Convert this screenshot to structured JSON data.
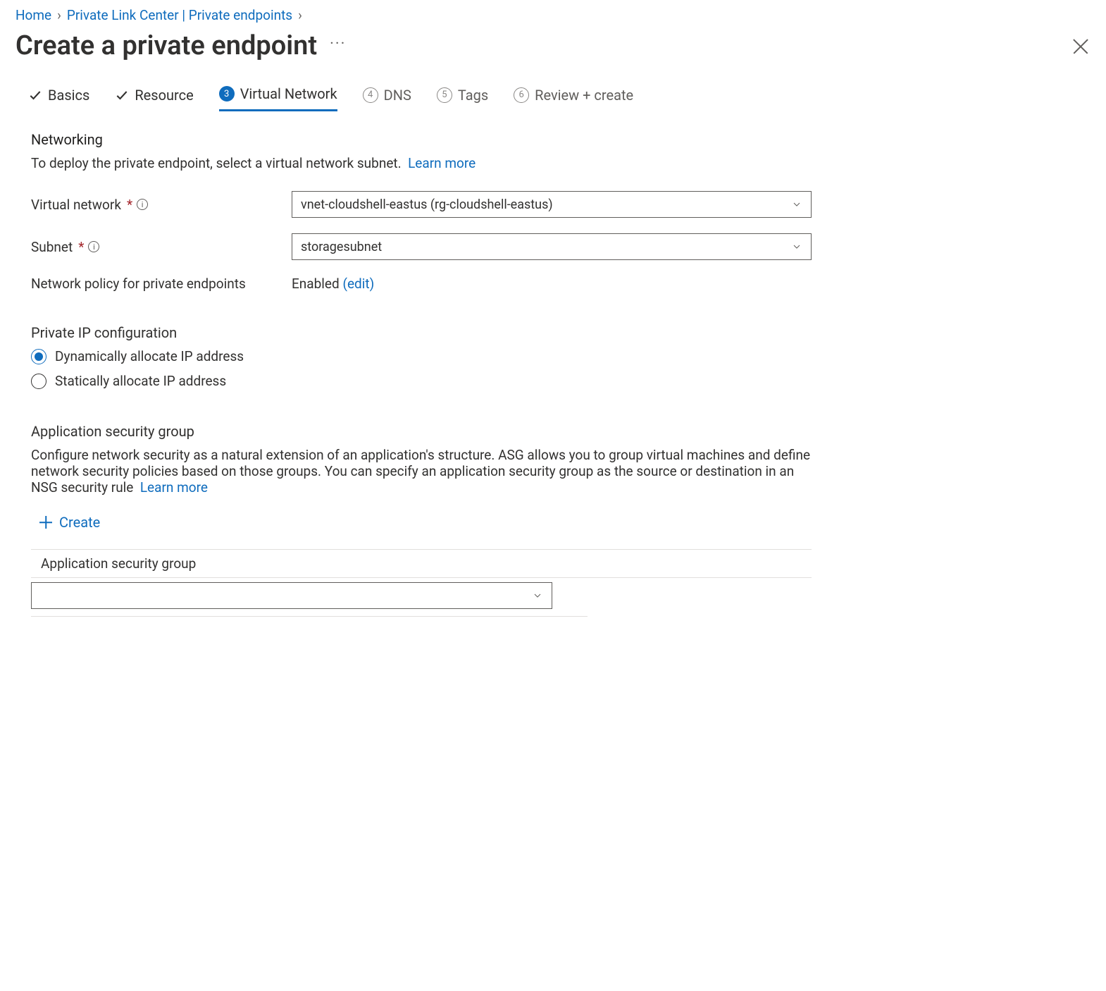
{
  "breadcrumb": {
    "home": "Home",
    "plc": "Private Link Center | Private endpoints"
  },
  "page_title": "Create a private endpoint",
  "tabs": {
    "basics": "Basics",
    "resource": "Resource",
    "vnet": "Virtual Network",
    "dns": "DNS",
    "tags": "Tags",
    "review": "Review + create",
    "step3": "3",
    "step4": "4",
    "step5": "5",
    "step6": "6"
  },
  "networking": {
    "heading": "Networking",
    "desc": "To deploy the private endpoint, select a virtual network subnet.",
    "learn_more": "Learn more",
    "vnet_label": "Virtual network",
    "vnet_value": "vnet-cloudshell-eastus (rg-cloudshell-eastus)",
    "subnet_label": "Subnet",
    "subnet_value": "storagesubnet",
    "policy_label": "Network policy for private endpoints",
    "policy_value": "Enabled",
    "policy_edit": "(edit)"
  },
  "ipconfig": {
    "heading": "Private IP configuration",
    "dynamic": "Dynamically allocate IP address",
    "static": "Statically allocate IP address",
    "selected": "dynamic"
  },
  "asg": {
    "heading": "Application security group",
    "desc": "Configure network security as a natural extension of an application's structure. ASG allows you to group virtual machines and define network security policies based on those groups. You can specify an application security group as the source or destination in an NSG security rule",
    "learn_more": "Learn more",
    "create": "Create",
    "column": "Application security group",
    "value": ""
  }
}
